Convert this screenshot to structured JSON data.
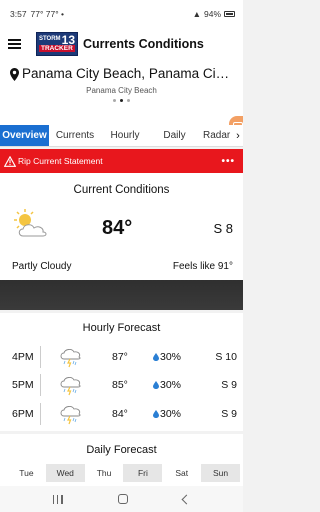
{
  "status_bar": {
    "time": "3:57",
    "temps": "77° 77° •",
    "battery": "94%"
  },
  "app_bar": {
    "title": "Currents Conditions",
    "logo_top": "STORM",
    "logo_bottom": "TRACKER",
    "logo_number": "13"
  },
  "location": {
    "name": "Panama City Beach, Panama City Beach",
    "subtitle": "Panama City Beach"
  },
  "tabs": [
    {
      "label": "Overview",
      "active": true
    },
    {
      "label": "Currents"
    },
    {
      "label": "Hourly"
    },
    {
      "label": "Daily"
    },
    {
      "label": "Radar"
    }
  ],
  "alert": {
    "text": "Rip Current Statement",
    "color": "#e8171d"
  },
  "current": {
    "title": "Current Conditions",
    "icon": "partly-cloudy-icon",
    "temp": "84°",
    "wind": "S 8",
    "condition": "Partly Cloudy",
    "feels_like": "Feels like 91°"
  },
  "hourly": {
    "title": "Hourly Forecast",
    "rows": [
      {
        "time": "4PM",
        "icon": "thunderstorm-icon",
        "temp": "87°",
        "precip": "30%",
        "wind": "S 10"
      },
      {
        "time": "5PM",
        "icon": "thunderstorm-icon",
        "temp": "85°",
        "precip": "30%",
        "wind": "S 9"
      },
      {
        "time": "6PM",
        "icon": "thunderstorm-icon",
        "temp": "84°",
        "precip": "30%",
        "wind": "S 9"
      }
    ]
  },
  "daily": {
    "title": "Daily Forecast",
    "days": [
      "Tue",
      "Wed",
      "Thu",
      "Fri",
      "Sat",
      "Sun"
    ]
  },
  "colors": {
    "accent": "#1a6fd1",
    "alert": "#e8171d",
    "drop": "#2a7fd4"
  }
}
